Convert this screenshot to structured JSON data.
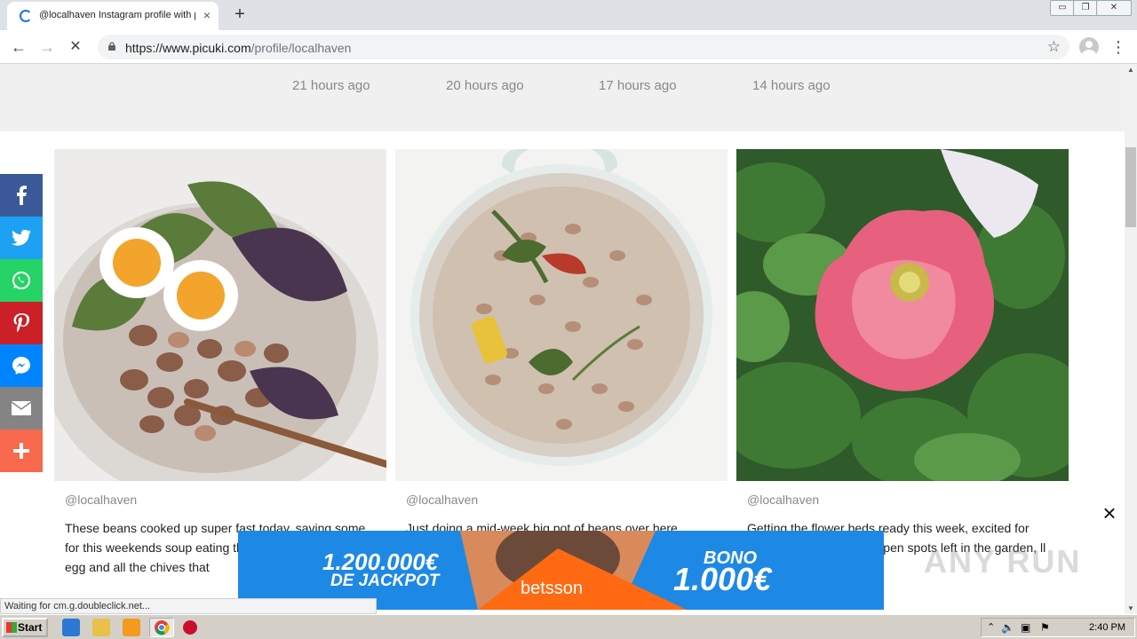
{
  "browser": {
    "tab_title": "@localhaven Instagram profile with p",
    "tab_close": "×",
    "new_tab": "+",
    "url_host": "https://www.picuki.com",
    "url_path": "/profile/localhaven",
    "back": "←",
    "forward": "→",
    "reload": "✕",
    "bookmark": "☆",
    "menu": "⋮",
    "win_min": "▭",
    "win_restore": "❐",
    "win_close": "✕"
  },
  "timestamps": [
    "21 hours ago",
    "20 hours ago",
    "17 hours ago",
    "14 hours ago"
  ],
  "posts": [
    {
      "user": "@localhaven",
      "caption": "These beans cooked up super fast today, saving some for this weekends soup eating them a little creamy wi an egg and all the chives that"
    },
    {
      "user": "@localhaven",
      "caption": "Just doing a mid-week big pot of beans over here"
    },
    {
      "user": "@localhaven",
      "caption": "Getting the flower beds ready this week, excited for come, especially these open spots left in the garden, ll me your favorites."
    }
  ],
  "share": [
    {
      "name": "facebook",
      "glyph": "f",
      "color": "#3b5998"
    },
    {
      "name": "twitter",
      "glyph": "t",
      "color": "#1da1f2"
    },
    {
      "name": "whatsapp",
      "glyph": "✆",
      "color": "#25d366"
    },
    {
      "name": "pinterest",
      "glyph": "P",
      "color": "#cb2027"
    },
    {
      "name": "messenger",
      "glyph": "✉",
      "color": "#0084ff"
    },
    {
      "name": "email",
      "glyph": "✉",
      "color": "#848484"
    },
    {
      "name": "more",
      "glyph": "+",
      "color": "#f8694d"
    }
  ],
  "ad": {
    "jackpot": "1.200.000€",
    "jackpot_sub": "DE JACKPOT",
    "brand": "betsson",
    "bono": "BONO",
    "bono_value": "1.000€",
    "close": "×"
  },
  "watermark": "ANY RUN",
  "status_text": "Waiting for cm.g.doubleclick.net...",
  "taskbar": {
    "start": "Start",
    "clock": "2:40 PM"
  }
}
